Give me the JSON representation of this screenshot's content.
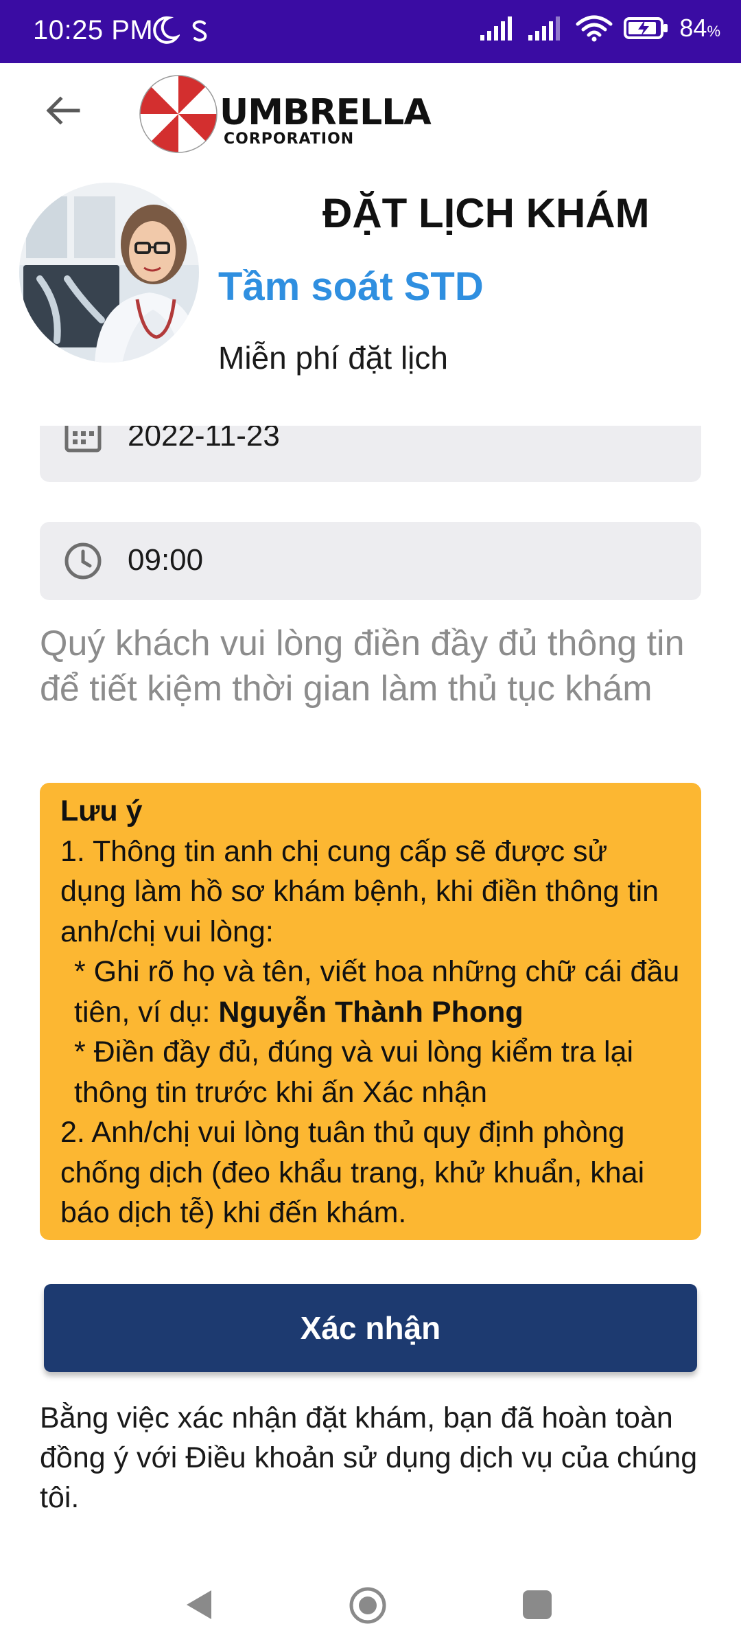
{
  "status_bar": {
    "time": "10:25 PM",
    "battery_percent": "84",
    "battery_unit": "%"
  },
  "header": {
    "logo_word": "UMBRELLA",
    "logo_sub": "CORPORATION"
  },
  "booking": {
    "title": "ĐẶT LỊCH KHÁM",
    "service": "Tầm soát STD",
    "fee": "Miễn phí đặt lịch"
  },
  "form": {
    "date": "2022-11-23",
    "time": "09:00",
    "hint": "Quý khách vui lòng điền đầy đủ thông tin để tiết kiệm thời gian làm thủ tục khám"
  },
  "note": {
    "heading": "Lưu ý",
    "item1": "1. Thông tin anh chị cung cấp sẽ được sử dụng làm hồ sơ khám bệnh, khi điền thông tin anh/chị vui lòng:",
    "bullet1_prefix": "* Ghi rõ họ và tên, viết hoa những chữ cái đầu tiên, ví dụ: ",
    "bullet1_example": "Nguyễn Thành Phong",
    "bullet2": "* Điền đầy đủ, đúng và vui lòng kiểm tra lại thông tin trước khi ấn Xác nhận",
    "item2": "2. Anh/chị vui lòng tuân thủ quy định phòng chống dịch (đeo khẩu trang, khử khuẩn, khai báo dịch tễ) khi đến khám."
  },
  "confirm_label": "Xác nhận",
  "terms": "Bằng việc xác nhận đặt khám, bạn đã hoàn toàn đồng ý với Điều khoản sử dụng dịch vụ của chúng tôi.",
  "colors": {
    "status_bar": "#3a0ca3",
    "service_blue": "#2f8fe0",
    "note_bg": "#fcb732",
    "button_bg": "#1d3a70",
    "field_bg": "#ededf0"
  },
  "icons": {
    "back": "arrow-left-icon",
    "date": "calendar-icon",
    "time": "clock-icon"
  }
}
